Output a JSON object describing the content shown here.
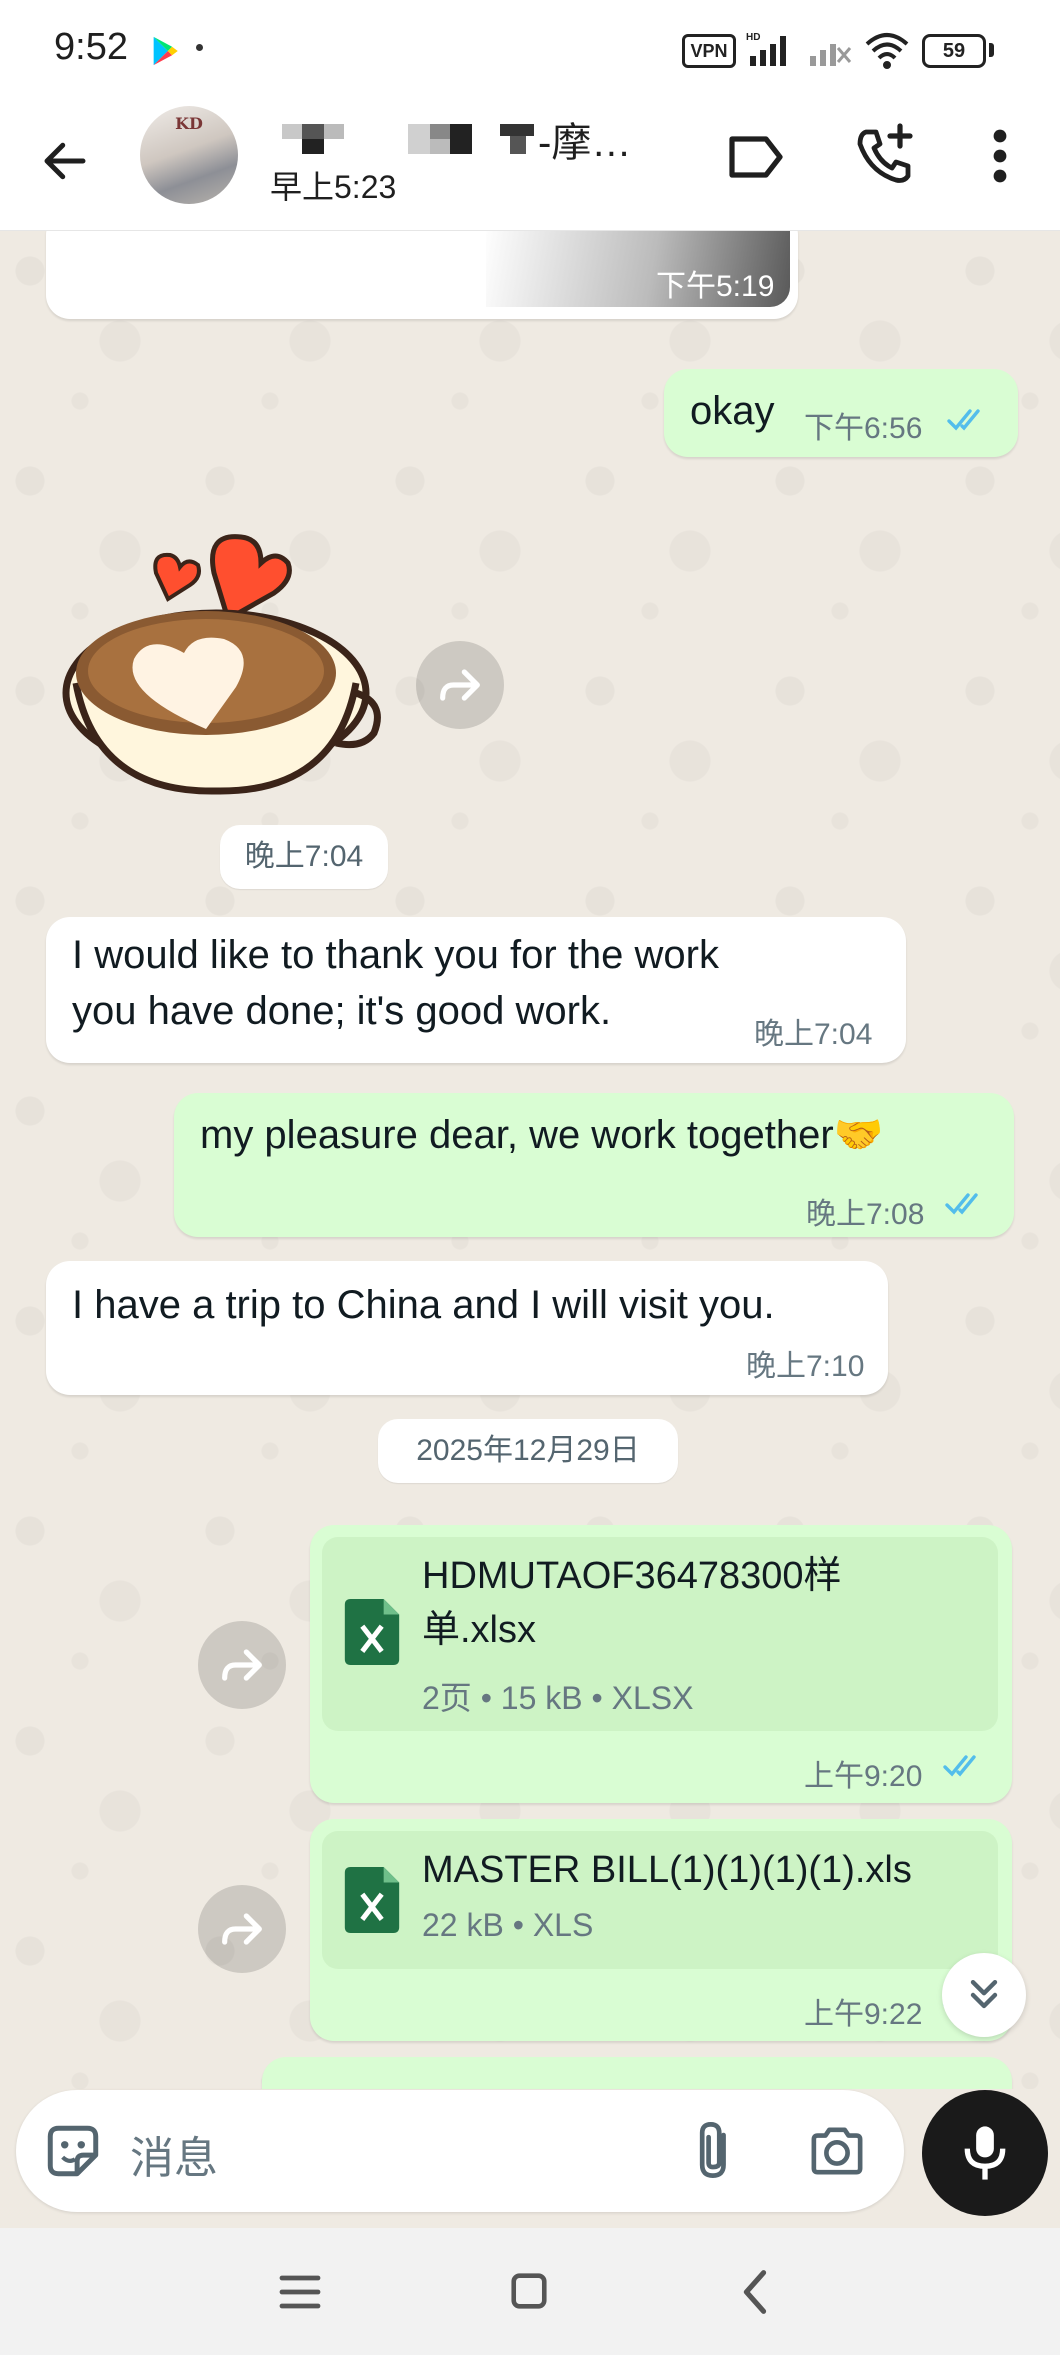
{
  "status_bar": {
    "time": "9:52",
    "vpn": "VPN",
    "battery": "59"
  },
  "header": {
    "contact_name": "-摩…",
    "last_seen": "早上5:23",
    "icons": [
      "back-arrow-icon",
      "label-icon",
      "call-add-icon",
      "more-vert-icon"
    ]
  },
  "messages": [
    {
      "dir": "in",
      "type": "image",
      "time": "下午5:19"
    },
    {
      "dir": "out",
      "type": "text",
      "text": "okay",
      "time": "下午6:56",
      "read": true
    },
    {
      "dir": "in",
      "type": "sticker",
      "sticker": "coffee-heart",
      "time": "晚上7:04"
    },
    {
      "dir": "in",
      "type": "text",
      "text_line1": "I would like to thank you for the work",
      "text_line2": "you have done; it's good work.",
      "time": "晚上7:04"
    },
    {
      "dir": "out",
      "type": "text",
      "text": "my pleasure dear, we work together🤝",
      "time": "晚上7:08",
      "read": true
    },
    {
      "dir": "in",
      "type": "text",
      "text": "I have a trip to China and I will visit you.",
      "time": "晚上7:10"
    }
  ],
  "date_divider": "2025年12月29日",
  "documents": [
    {
      "name_line1": "HDMUTAOF36478300样",
      "name_line2": "单.xlsx",
      "meta": "2页 • 15 kB • XLSX",
      "time": "上午9:20",
      "read": true
    },
    {
      "name": "MASTER BILL(1)(1)(1)(1).xls",
      "meta": "22 kB • XLS",
      "time": "上午9:22",
      "read": true
    }
  ],
  "input": {
    "placeholder": "消息"
  },
  "colors": {
    "outgoing_bubble": "#d9fdd3",
    "incoming_bubble": "#ffffff",
    "chat_background": "#efeae2",
    "read_ticks": "#53bdeb",
    "excel_green": "#1f7244"
  }
}
